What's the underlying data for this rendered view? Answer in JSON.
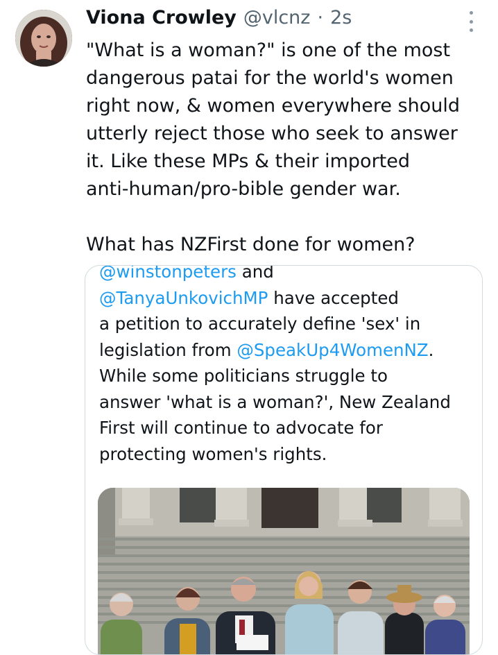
{
  "tweet": {
    "author_name": "Viona Crowley",
    "handle": "@vlcnz",
    "separator": "·",
    "time": "2s",
    "lines": [
      "\"What is a woman?\" is one of the most",
      "dangerous patai for the world's women",
      "right now, & women everywhere should",
      "utterly reject those who seek to answer",
      "it. Like these MPs & their imported",
      "anti-human/pro-bible gender war."
    ],
    "last_line": "What has NZFirst done for women?"
  },
  "quote": {
    "mention_1": "@winstonpeters",
    "and_text": " and",
    "mention_2": "@TanyaUnkovichMP",
    "after_mention_2": " have accepted",
    "line_3": "a petition to accurately define 'sex' in",
    "line_4_pre": "legislation from ",
    "mention_3": "@SpeakUp4WomenNZ",
    "line_4_post": ".",
    "line_5": "While some politicians struggle to",
    "line_6": "answer 'what is a woman?', New Zealand",
    "line_7": "First will continue to advocate for",
    "line_8": "protecting women's rights."
  },
  "icons": {
    "avatar": "profile-photo",
    "more": "more-vertical-icon",
    "photo": "group-photo-on-parliament-steps"
  }
}
